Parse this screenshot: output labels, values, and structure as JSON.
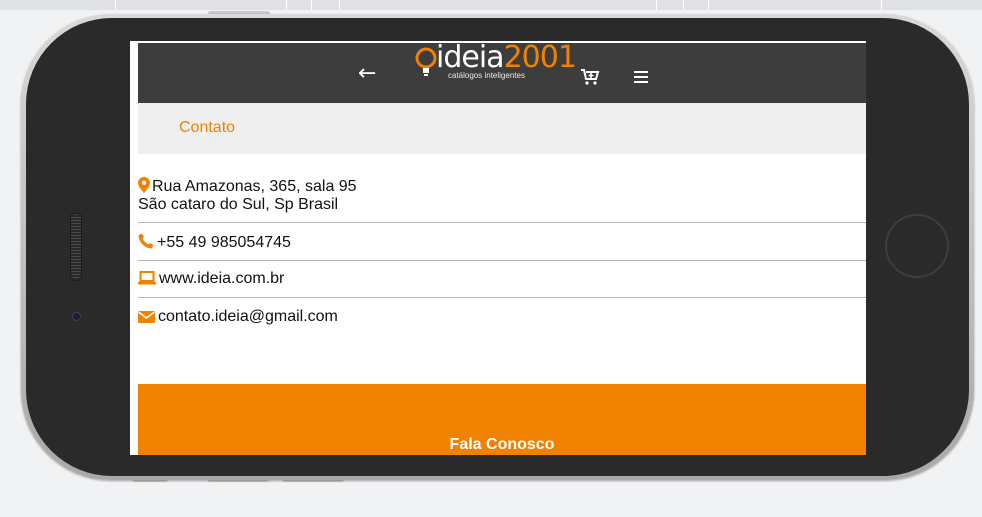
{
  "header": {
    "back_label": "←",
    "logo": {
      "word": "ideia",
      "number": "2001",
      "tagline": "catálogos inteligentes"
    },
    "icons": [
      "back-arrow-icon",
      "add-to-cart-icon",
      "menu-icon"
    ]
  },
  "page": {
    "title": "Contato"
  },
  "contacts": {
    "address": {
      "line1": "Rua Amazonas, 365, sala 95",
      "line2": "São cataro do Sul, Sp Brasil",
      "icon": "map-marker-icon"
    },
    "phone": {
      "value": "+55 49 985054745",
      "icon": "phone-icon"
    },
    "website": {
      "value": "www.ideia.com.br",
      "icon": "laptop-icon"
    },
    "email": {
      "value": "contato.ideia@gmail.com",
      "icon": "envelope-icon"
    }
  },
  "cta": {
    "label": "Fala Conosco"
  },
  "colors": {
    "accent": "#f08200",
    "header_bg": "#3d3d3d",
    "subbar_bg": "#efefef",
    "phone_body": "#2a2a2a"
  }
}
